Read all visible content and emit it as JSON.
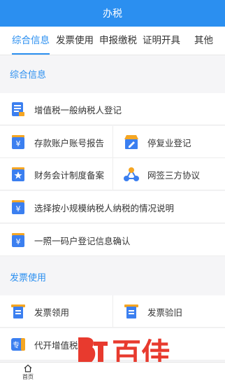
{
  "title": "办税",
  "tabs": [
    "综合信息",
    "发票使用",
    "申报缴税",
    "证明开具",
    "其他"
  ],
  "sections": {
    "general": {
      "heading": "综合信息",
      "items": [
        {
          "label": "增值税一般纳税人登记",
          "icon": "document-list-icon"
        },
        {
          "label": "存款账户账号报告",
          "icon": "yen-card-icon"
        },
        {
          "label": "停复业登记",
          "icon": "shop-edit-icon"
        },
        {
          "label": "财务会计制度备案",
          "icon": "star-card-icon"
        },
        {
          "label": "网签三方协议",
          "icon": "network-nodes-icon"
        },
        {
          "label": "选择按小规模纳税人纳税的情况说明",
          "icon": "yen-card-icon"
        },
        {
          "label": "一照一码户登记信息确认",
          "icon": "yen-card-icon"
        }
      ]
    },
    "invoice": {
      "heading": "发票使用",
      "items": [
        {
          "label": "发票领用",
          "icon": "invoice-icon"
        },
        {
          "label": "发票验旧",
          "icon": "invoice-icon"
        },
        {
          "label": "代开增值税",
          "icon": "special-invoice-icon",
          "badge": "专"
        }
      ]
    }
  },
  "bottom_nav": {
    "home": "首页"
  },
  "watermark": {
    "text": "百佳"
  },
  "colors": {
    "accent": "#2b8ff0",
    "icon_orange": "#f5a623",
    "icon_blue": "#3b7ff0"
  }
}
